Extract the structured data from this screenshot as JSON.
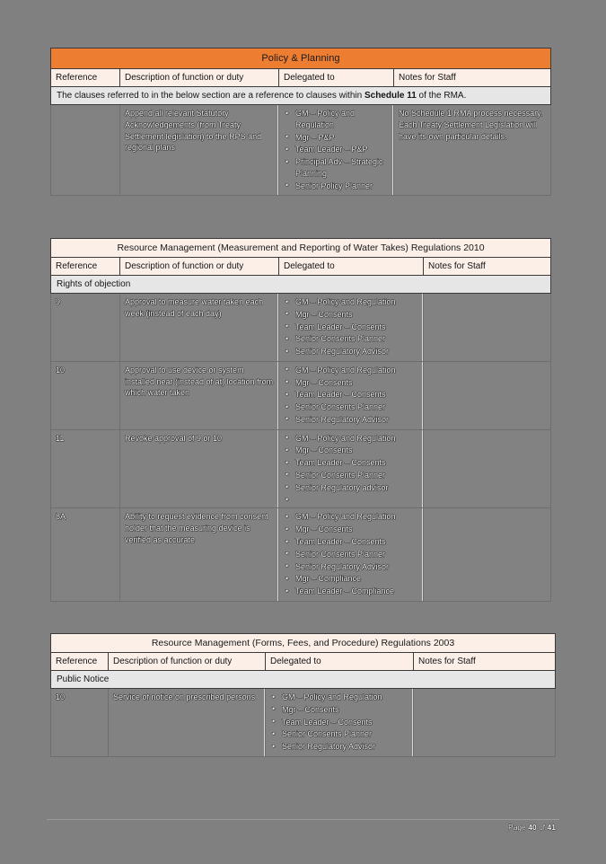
{
  "page": {
    "background_color": "#808080",
    "footer": {
      "page_label_prefix": "Page ",
      "page_current": "40",
      "page_middle": " of ",
      "page_total": "41",
      "full_text": "Page 40 of 41"
    }
  },
  "colors": {
    "banner_orange": "#ED7D31",
    "banner_cream": "#FBEFE8",
    "subhead_grey": "#E6E6E6",
    "body_grey": "#828282",
    "border_dark": "#1a1a1a"
  },
  "columns": {
    "reference": "Reference",
    "description": "Description of function or duty",
    "delegated": "Delegated to",
    "notes": "Notes for Staff"
  },
  "tables": [
    {
      "id": "policy-planning",
      "banner": "Policy & Planning",
      "banner_style": "orange",
      "note_row_prefix": "The clauses referred to in the below section are a reference to clauses within ",
      "note_row_bold": "Schedule 11",
      "note_row_suffix": " of the RMA.",
      "rows": [
        {
          "reference": "",
          "description": "Append all relevant Statutory Acknowledgements (from Treaty Settlement legislation) to the RPS and regional plans",
          "delegated": [
            "GM – Policy and Regulation",
            "Mgr – P&P",
            "Team Leader – P&P",
            "Principal Adv – Strategic Planning",
            "Senior Policy Planner"
          ],
          "notes": "No Schedule 1 RMA process necessary. Each Treaty Settlement Legislation will have its own particular details."
        }
      ]
    },
    {
      "id": "water-takes-2010",
      "banner": "Resource Management (Measurement and Reporting of Water Takes) Regulations 2010",
      "banner_style": "cream",
      "subhead": "Rights of objection",
      "rows": [
        {
          "reference": "9",
          "description": "Approval to measure water taken each week (instead of each day)",
          "delegated": [
            "GM – Policy and Regulation",
            "Mgr – Consents",
            "Team Leader – Consents",
            "Senior Consents Planner",
            "Senior Regulatory Advisor"
          ],
          "notes": ""
        },
        {
          "reference": "10",
          "description": "Approval to use device or system installed near (instead of at) location from which water taken",
          "delegated": [
            "GM – Policy and Regulation",
            "Mgr – Consents",
            "Team Leader – Consents",
            "Senior Consents Planner",
            "Senior Regulatory Advisor"
          ],
          "notes": ""
        },
        {
          "reference": "11",
          "description": "Revoke approval of 9 or 10",
          "delegated": [
            "GM – Policy and Regulation",
            "Mgr – Consents",
            "Team Leader – Consents",
            "Senior Consents Planner",
            "Senior Regulatory advisor",
            ""
          ],
          "notes": ""
        },
        {
          "reference": "8A",
          "description": "Ability to request evidence from consent holder that the measuring device is verified as accurate",
          "delegated": [
            "GM – Policy and Regulation",
            "Mgr – Consents",
            "Team Leader – Consents",
            "Senior Consents Planner",
            "Senior Regulatory Advisor",
            "Mgr – Compliance",
            "Team Leader – Compliance"
          ],
          "notes": ""
        }
      ]
    },
    {
      "id": "forms-fees-2003",
      "banner": "Resource Management (Forms, Fees, and Procedure) Regulations 2003",
      "banner_style": "cream",
      "subhead": "Public Notice",
      "rows": [
        {
          "reference": "10",
          "description": "Service of notice on prescribed persons",
          "delegated": [
            "GM – Policy and Regulation",
            "Mgr – Consents",
            "Team Leader – Consents",
            "Senior Consents Planner",
            "Senior Regulatory Advisor"
          ],
          "notes": ""
        }
      ]
    }
  ]
}
